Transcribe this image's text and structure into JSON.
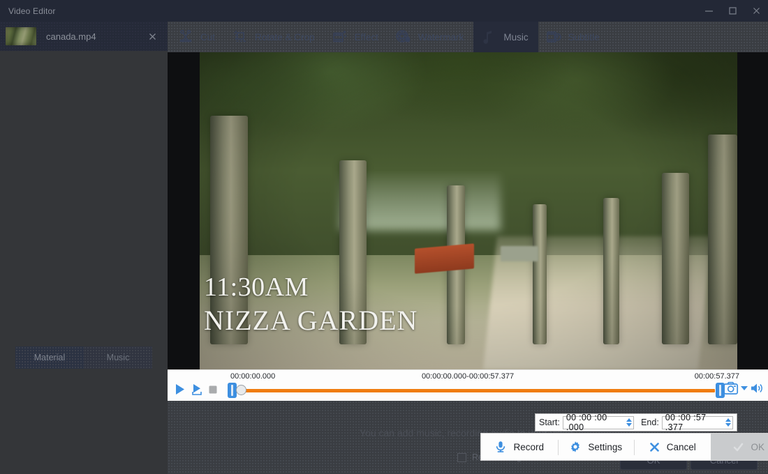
{
  "window": {
    "title": "Video Editor",
    "minimize_icon": "minimize-icon",
    "maximize_icon": "maximize-icon",
    "close_icon": "close-icon"
  },
  "sidebar": {
    "file_tab": {
      "name": "canada.mp4",
      "close_icon": "close-icon",
      "thumbnail": "video-thumbnail"
    },
    "library_tabs": [
      {
        "label": "Material",
        "active": true
      },
      {
        "label": "Music",
        "active": false
      }
    ]
  },
  "toolbar": {
    "items": [
      {
        "label": "Cut",
        "icon": "scissors-icon",
        "active": false
      },
      {
        "label": "Rotate & Crop",
        "icon": "crop-icon",
        "active": false
      },
      {
        "label": "Effect",
        "icon": "film-sparkle-icon",
        "active": false
      },
      {
        "label": "Watermark",
        "icon": "watermark-drop-icon",
        "active": false
      },
      {
        "label": "Music",
        "icon": "music-note-icon",
        "active": true
      },
      {
        "label": "Subtitle",
        "icon": "subtitle-icon",
        "active": false
      }
    ]
  },
  "preview": {
    "overlay_line1": "11:30AM",
    "overlay_line2": "NIZZA GARDEN"
  },
  "timeline": {
    "current_time": "00:00:00.000",
    "range_label": "00:00:00.000-00:00:57.377",
    "total_time": "00:00:57.377",
    "play_icon": "play-icon",
    "step_icon": "play-step-icon",
    "stop_icon": "stop-icon",
    "snapshot_icon": "camera-icon",
    "dropdown_icon": "chevron-down-icon",
    "volume_icon": "volume-icon",
    "track_color": "#f07d11",
    "handle_color": "#3d8fe0"
  },
  "trim_dialog": {
    "start_label": "Start:",
    "start_value": "00 :00 :00 .000",
    "end_label": "End:",
    "end_value": "00 :00 :57 .377"
  },
  "action_bar": {
    "items": [
      {
        "label": "Record",
        "icon": "microphone-icon",
        "disabled": false
      },
      {
        "label": "Settings",
        "icon": "gear-icon",
        "disabled": false
      },
      {
        "label": "Cancel",
        "icon": "x-icon",
        "disabled": false
      },
      {
        "label": "OK",
        "icon": "check-icon",
        "disabled": true
      }
    ]
  },
  "music_panel": {
    "hint": "You can add music, recording audio to your video.",
    "remove_sound_label": "Remove original sound from video",
    "remove_sound_checked": false,
    "ok_label": "OK",
    "cancel_label": "Cancel"
  }
}
